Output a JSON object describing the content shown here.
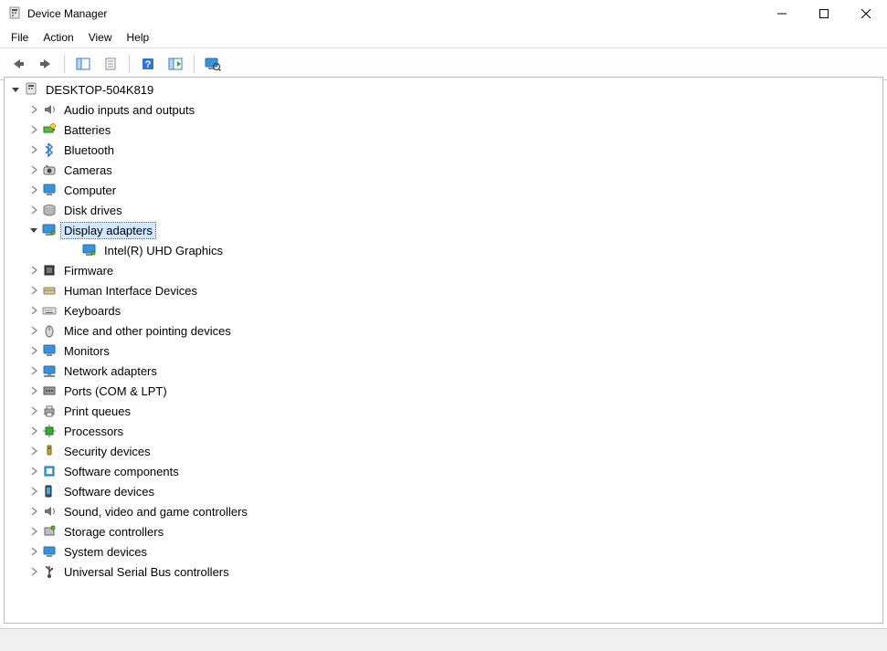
{
  "window": {
    "title": "Device Manager"
  },
  "menubar": {
    "items": [
      "File",
      "Action",
      "View",
      "Help"
    ]
  },
  "toolbar": {
    "buttons": [
      {
        "name": "back-icon",
        "tip": "Back"
      },
      {
        "name": "forward-icon",
        "tip": "Forward"
      },
      {
        "name": "sep"
      },
      {
        "name": "show-hide-console-tree-icon",
        "tip": "Show/Hide Console Tree"
      },
      {
        "name": "properties-icon",
        "tip": "Properties"
      },
      {
        "name": "sep"
      },
      {
        "name": "help-icon",
        "tip": "Help"
      },
      {
        "name": "action-center-icon",
        "tip": "Action"
      },
      {
        "name": "sep"
      },
      {
        "name": "scan-hardware-icon",
        "tip": "Scan for hardware changes"
      }
    ]
  },
  "tree": {
    "root": {
      "label": "DESKTOP-504K819",
      "icon": "computer-icon",
      "expanded": true
    },
    "categories": [
      {
        "label": "Audio inputs and outputs",
        "icon": "audio-icon",
        "expanded": false
      },
      {
        "label": "Batteries",
        "icon": "battery-icon",
        "expanded": false
      },
      {
        "label": "Bluetooth",
        "icon": "bluetooth-icon",
        "expanded": false
      },
      {
        "label": "Cameras",
        "icon": "camera-icon",
        "expanded": false
      },
      {
        "label": "Computer",
        "icon": "monitor-icon",
        "expanded": false
      },
      {
        "label": "Disk drives",
        "icon": "disk-icon",
        "expanded": false
      },
      {
        "label": "Display adapters",
        "icon": "display-icon",
        "expanded": true,
        "selected": true,
        "children": [
          {
            "label": "Intel(R) UHD Graphics",
            "icon": "display-icon"
          }
        ]
      },
      {
        "label": "Firmware",
        "icon": "firmware-icon",
        "expanded": false
      },
      {
        "label": "Human Interface Devices",
        "icon": "hid-icon",
        "expanded": false
      },
      {
        "label": "Keyboards",
        "icon": "keyboard-icon",
        "expanded": false
      },
      {
        "label": "Mice and other pointing devices",
        "icon": "mouse-icon",
        "expanded": false
      },
      {
        "label": "Monitors",
        "icon": "monitor-icon",
        "expanded": false
      },
      {
        "label": "Network adapters",
        "icon": "network-icon",
        "expanded": false
      },
      {
        "label": "Ports (COM & LPT)",
        "icon": "ports-icon",
        "expanded": false
      },
      {
        "label": "Print queues",
        "icon": "printer-icon",
        "expanded": false
      },
      {
        "label": "Processors",
        "icon": "cpu-icon",
        "expanded": false
      },
      {
        "label": "Security devices",
        "icon": "security-icon",
        "expanded": false
      },
      {
        "label": "Software components",
        "icon": "softcomp-icon",
        "expanded": false
      },
      {
        "label": "Software devices",
        "icon": "softdev-icon",
        "expanded": false
      },
      {
        "label": "Sound, video and game controllers",
        "icon": "audio-icon",
        "expanded": false
      },
      {
        "label": "Storage controllers",
        "icon": "storage-icon",
        "expanded": false
      },
      {
        "label": "System devices",
        "icon": "system-icon",
        "expanded": false
      },
      {
        "label": "Universal Serial Bus controllers",
        "icon": "usb-icon",
        "expanded": false
      }
    ]
  }
}
